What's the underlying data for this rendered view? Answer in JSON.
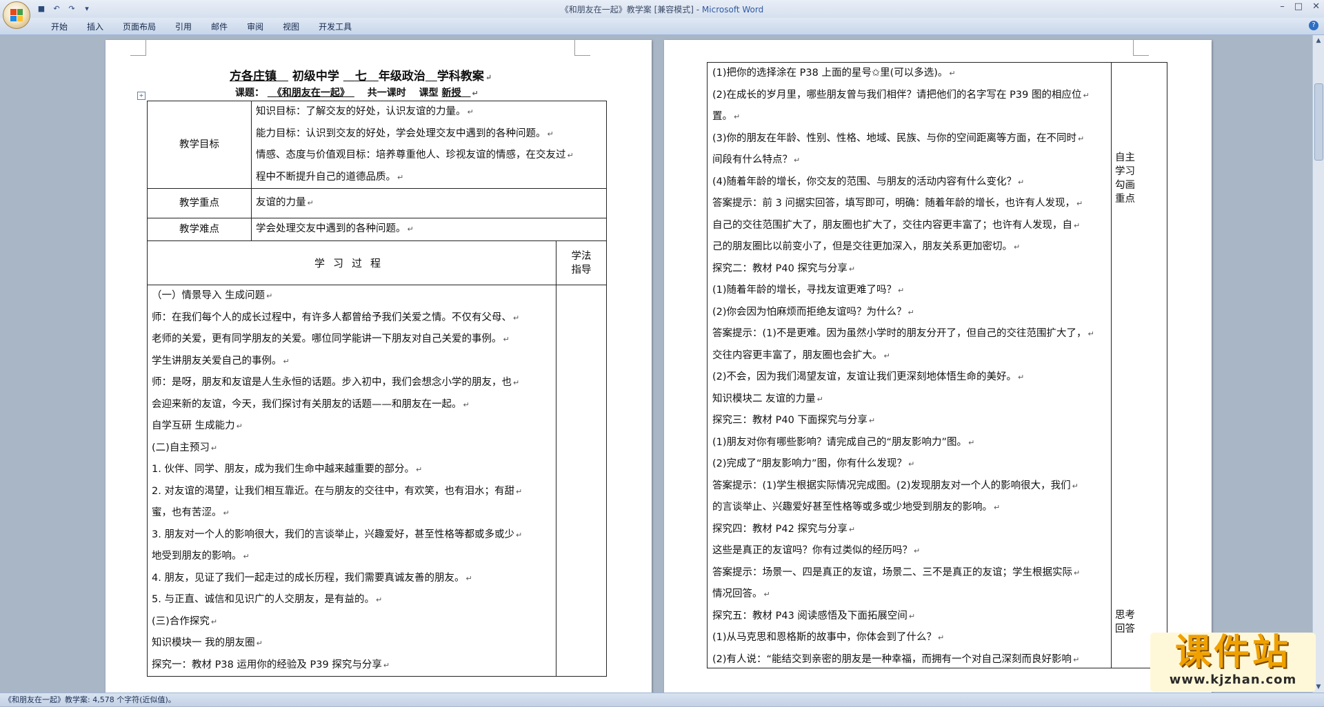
{
  "window": {
    "title": "《和朋友在一起》教学案 [兼容模式] - ",
    "app": "Microsoft Word",
    "controls": [
      "–",
      "□",
      "✕"
    ]
  },
  "ribbon": {
    "tabs": [
      "开始",
      "插入",
      "页面布局",
      "引用",
      "邮件",
      "审阅",
      "视图",
      "开发工具"
    ]
  },
  "status": {
    "text": "《和朋友在一起》教学案: 4,578 个字符(近似值)。"
  },
  "left_page": {
    "header_line1": {
      "town": "方各庄镇",
      "school": "初级中学",
      "grade": "七",
      "subject": "年级政治",
      "suffix": "学科教案"
    },
    "header_line2": {
      "label": "课题：",
      "topic": "《和朋友在一起》",
      "hours": "共一课时",
      "type_label": "课型",
      "type": "新授"
    },
    "goals_label": "教学目标",
    "goals": [
      "知识目标：了解交友的好处，认识友谊的力量。",
      "能力目标：认识到交友的好处，学会处理交友中遇到的各种问题。",
      "情感、态度与价值观目标：培养尊重他人、珍视友谊的情感，在交友过",
      "程中不断提升自己的道德品质。"
    ],
    "key_label": "教学重点",
    "key": "友谊的力量",
    "difficulty_label": "教学难点",
    "difficulty": "学会处理交友中遇到的各种问题。",
    "process_title": "学习过程",
    "method_label": "学法指导",
    "process": [
      "（一）情景导入 生成问题",
      "师：在我们每个人的成长过程中，有许多人都曾给予我们关爱之情。不仅有父母、",
      "老师的关爱，更有同学朋友的关爱。哪位同学能讲一下朋友对自己关爱的事例。",
      "学生讲朋友关爱自己的事例。",
      "师：是呀，朋友和友谊是人生永恒的话题。步入初中，我们会想念小学的朋友，也",
      "会迎来新的友谊，今天，我们探讨有关朋友的话题——和朋友在一起。",
      "自学互研 生成能力",
      "(二)自主预习",
      "1. 伙伴、同学、朋友，成为我们生命中越来越重要的部分。",
      "2. 对友谊的渴望，让我们相互靠近。在与朋友的交往中，有欢笑，也有泪水；有甜",
      "蜜，也有苦涩。",
      "3. 朋友对一个人的影响很大，我们的言谈举止，兴趣爱好，甚至性格等都或多或少",
      "地受到朋友的影响。",
      "4. 朋友，见证了我们一起走过的成长历程，我们需要真诚友善的朋友。",
      "5. 与正直、诚信和见识广的人交朋友，是有益的。",
      "(三)合作探究",
      "知识模块一 我的朋友圈",
      "探究一：教材 P38 运用你的经验及 P39 探究与分享"
    ]
  },
  "right_page": {
    "lines": [
      "(1)把你的选择涂在 P38 上面的星号✩里(可以多选)。",
      "(2)在成长的岁月里，哪些朋友曾与我们相伴？请把他们的名字写在 P39 图的相应位",
      "置。",
      "(3)你的朋友在年龄、性别、性格、地域、民族、与你的空间距离等方面，在不同时",
      "间段有什么特点？",
      "(4)随着年龄的增长，你交友的范围、与朋友的活动内容有什么变化？",
      "答案提示：前 3 问据实回答，填写即可，明确：随着年龄的增长，也许有人发现，",
      "自己的交往范围扩大了，朋友圈也扩大了，交往内容更丰富了；也许有人发现，自",
      "己的朋友圈比以前变小了，但是交往更加深入，朋友关系更加密切。",
      "探究二：教材 P40 探究与分享",
      "(1)随着年龄的增长，寻找友谊更难了吗？",
      "(2)你会因为怕麻烦而拒绝友谊吗？为什么？",
      "答案提示：(1)不是更难。因为虽然小学时的朋友分开了，但自己的交往范围扩大了，",
      "交往内容更丰富了，朋友圈也会扩大。",
      "(2)不会，因为我们渴望友谊，友谊让我们更深刻地体悟生命的美好。",
      "知识模块二 友谊的力量",
      "探究三：教材 P40 下面探究与分享",
      "(1)朋友对你有哪些影响？请完成自己的“朋友影响力”图。",
      "(2)完成了“朋友影响力”图，你有什么发现？",
      "答案提示：(1)学生根据实际情况完成图。(2)发现朋友对一个人的影响很大，我们",
      "的言谈举止、兴趣爱好甚至性格等或多或少地受到朋友的影响。",
      "探究四：教材 P42 探究与分享",
      "这些是真正的友谊吗？你有过类似的经历吗？",
      "答案提示：场景一、四是真正的友谊，场景二、三不是真正的友谊；学生根据实际",
      "情况回答。",
      "探究五：教材 P43 阅读感悟及下面拓展空间",
      "(1)从马克思和恩格斯的故事中，你体会到了什么？",
      "(2)有人说：“能结交到亲密的朋友是一种幸福，而拥有一个对自己深刻而良好影响"
    ],
    "side_notes": [
      {
        "lines": [
          "自主",
          "学习",
          "勾画",
          "重点"
        ]
      },
      {
        "lines": [
          "思考",
          "回答"
        ]
      }
    ]
  },
  "watermark": {
    "text": "课件站",
    "url": "www.kjzhan.com"
  },
  "colors": {
    "accent": "#2f5aa3",
    "watermark": "#f0a100"
  }
}
